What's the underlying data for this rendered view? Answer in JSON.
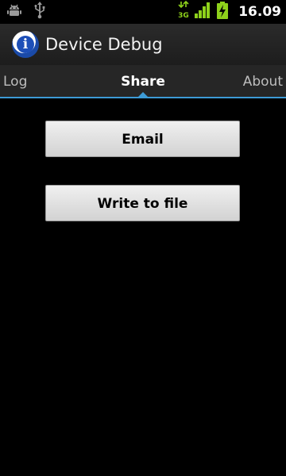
{
  "status_bar": {
    "time": "16.09",
    "network": "3G",
    "icons": [
      "android-debug-icon",
      "usb-icon",
      "network-3g-icon",
      "signal-strength-icon",
      "battery-charging-icon"
    ]
  },
  "app": {
    "title": "Device Debug",
    "icon": "info-icon",
    "icon_glyph": "i"
  },
  "tabs": [
    {
      "label": "Log"
    },
    {
      "label": "Share",
      "selected": true
    },
    {
      "label": "About"
    }
  ],
  "actions": {
    "email_label": "Email",
    "write_label": "Write to file"
  },
  "colors": {
    "accent": "#3d9bd6",
    "status_green": "#8ed11b"
  }
}
